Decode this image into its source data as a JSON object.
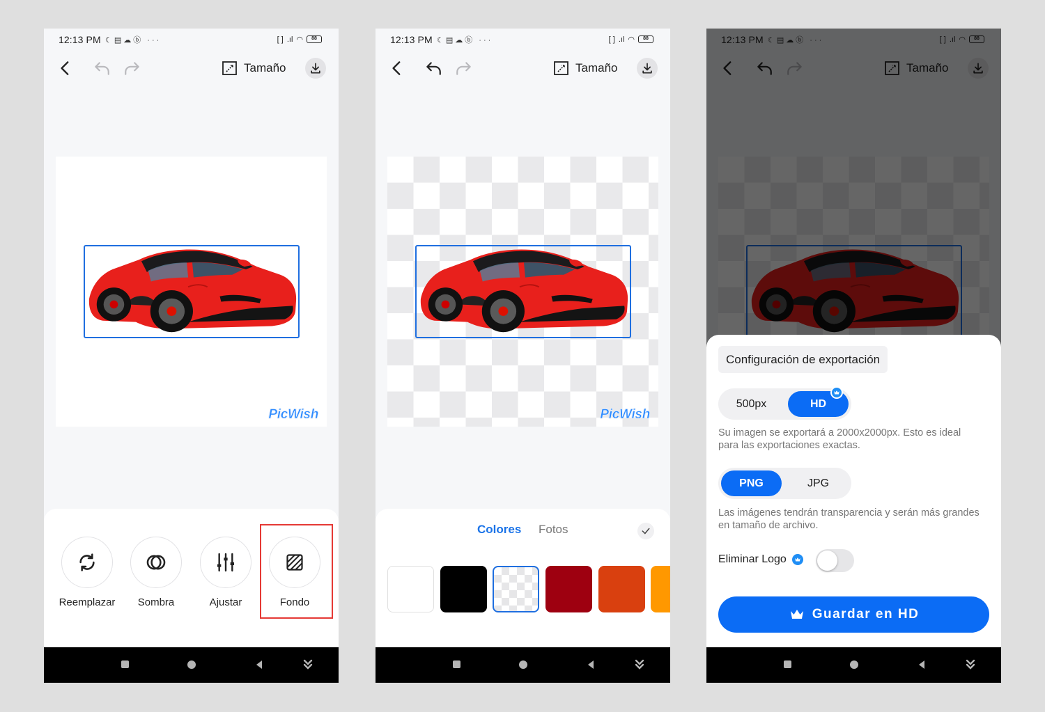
{
  "status_bar": {
    "time": "12:13 PM",
    "battery": "88"
  },
  "toolbar": {
    "size_label": "Tamaño"
  },
  "watermark": "PicWish",
  "tools": [
    {
      "label": "Reemplazar",
      "icon": "replace-icon"
    },
    {
      "label": "Sombra",
      "icon": "shadow-icon"
    },
    {
      "label": "Ajustar",
      "icon": "adjust-sliders-icon"
    },
    {
      "label": "Fondo",
      "icon": "background-icon"
    }
  ],
  "background_panel": {
    "tab_colors": "Colores",
    "tab_photos": "Fotos",
    "swatches": [
      "#ffffff",
      "#000000",
      "transparent",
      "#9e0010",
      "#d9400f",
      "#ff9800"
    ],
    "selected_swatch": "transparent"
  },
  "export": {
    "title": "Configuración de exportación",
    "size_options": [
      "500px",
      "HD"
    ],
    "size_selected": "HD",
    "size_desc": "Su imagen se exportará a 2000x2000px. Esto es ideal para las exportaciones exactas.",
    "format_options": [
      "PNG",
      "JPG"
    ],
    "format_selected": "PNG",
    "format_desc": "Las imágenes tendrán transparencia y serán más grandes en tamaño de archivo.",
    "remove_logo_label": "Eliminar Logo",
    "remove_logo_on": false,
    "save_label": "Guardar en HD"
  },
  "colors": {
    "accent": "#0b6cf5",
    "highlight": "#e53935"
  }
}
